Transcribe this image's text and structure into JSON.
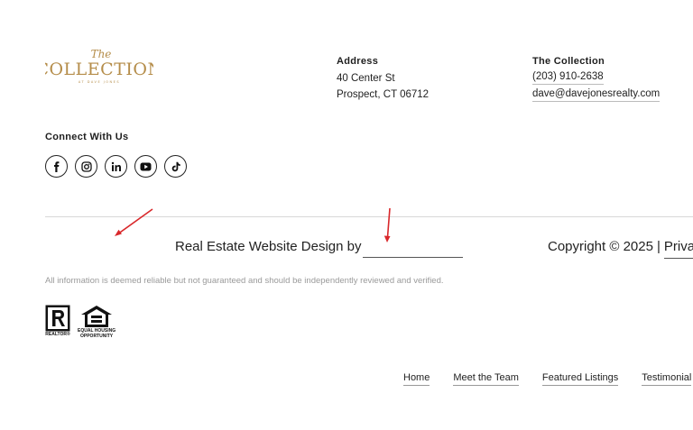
{
  "logo": {
    "script": "The",
    "wordmark": "COLLECTION",
    "tagline": "AT DAVE JONES",
    "color": "#b58d4a"
  },
  "address": {
    "title": "Address",
    "line1": "40 Center St",
    "line2": "Prospect, CT 06712"
  },
  "contact": {
    "title": "The Collection",
    "phone": "(203) 910-2638",
    "email": "dave@davejonesrealty.com"
  },
  "connect": {
    "title": "Connect With Us",
    "icons": [
      "facebook-icon",
      "instagram-icon",
      "linkedin-icon",
      "youtube-icon",
      "tiktok-icon"
    ]
  },
  "credit": {
    "text": "Real Estate Website Design by"
  },
  "copyright": {
    "text": "Copyright © 2025",
    "separator": "|",
    "privacy": "Priva"
  },
  "disclaimer": "All information is deemed reliable but not guaranteed and should be independently reviewed and verified.",
  "badges": {
    "realtor_caption": "REALTOR®",
    "eho_caption_1": "EQUAL HOUSING",
    "eho_caption_2": "OPPORTUNITY"
  },
  "nav": {
    "items": [
      "Home",
      "Meet the Team",
      "Featured Listings",
      "Testimonial"
    ]
  },
  "annotation_color": "#d9282b"
}
